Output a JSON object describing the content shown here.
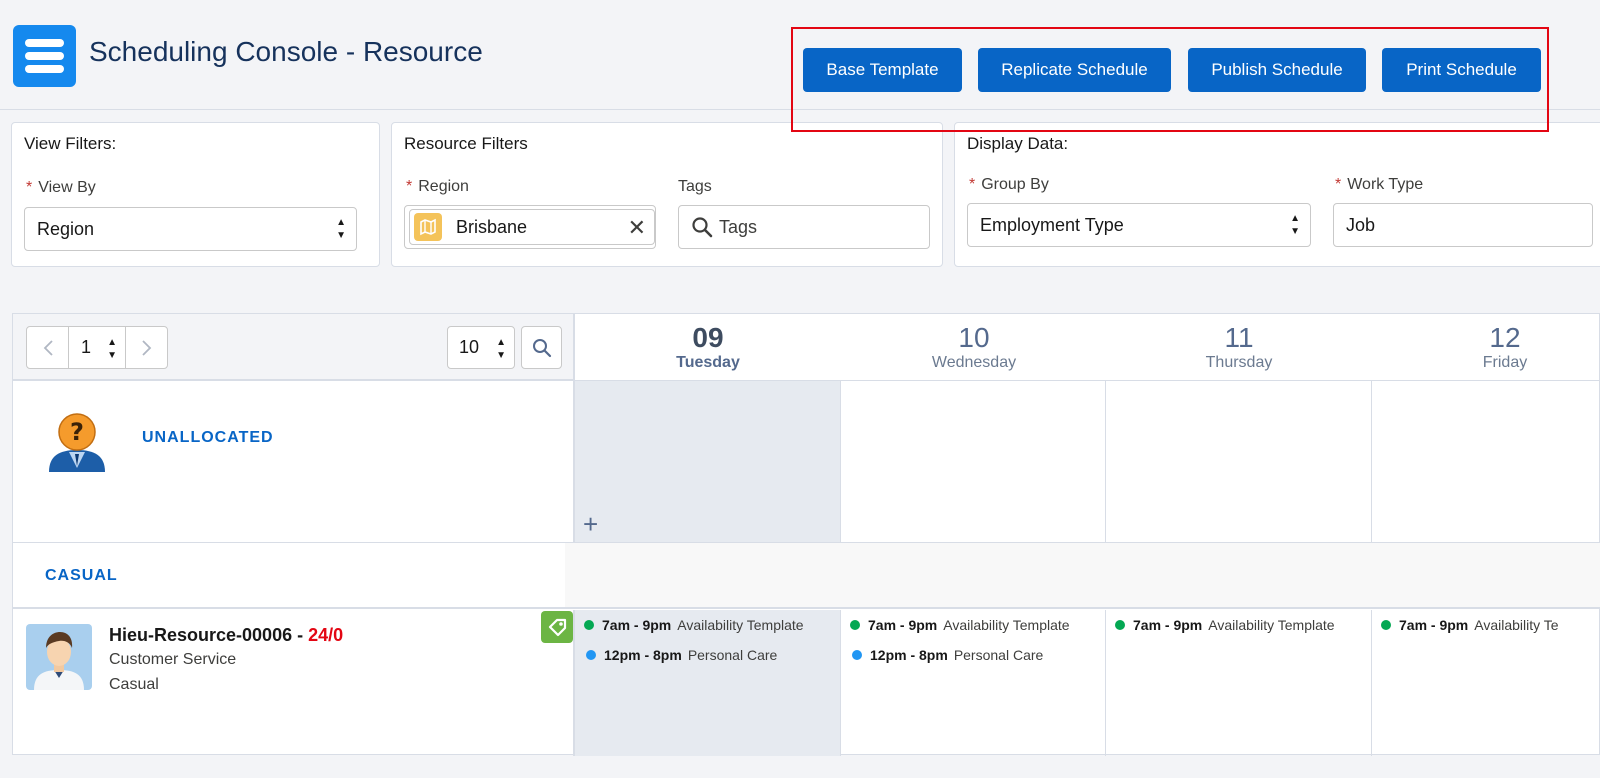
{
  "header": {
    "title": "Scheduling Console - Resource",
    "buttons": {
      "base_template": "Base Template",
      "replicate": "Replicate Schedule",
      "publish": "Publish Schedule",
      "print": "Print Schedule"
    }
  },
  "view_filters": {
    "title": "View Filters:",
    "view_by_label": "View By",
    "view_by_value": "Region"
  },
  "resource_filters": {
    "title": "Resource Filters",
    "region_label": "Region",
    "region_pill": "Brisbane",
    "tags_label": "Tags",
    "tags_placeholder": "Tags"
  },
  "display_data": {
    "title": "Display Data:",
    "group_by_label": "Group By",
    "group_by_value": "Employment Type",
    "work_type_label": "Work Type",
    "work_type_value": "Job"
  },
  "pager": {
    "page": "1",
    "page_size": "10"
  },
  "days": [
    {
      "num": "09",
      "name": "Tuesday"
    },
    {
      "num": "10",
      "name": "Wednesday"
    },
    {
      "num": "11",
      "name": "Thursday"
    },
    {
      "num": "12",
      "name": "Friday"
    }
  ],
  "unallocated_label": "UNALLOCATED",
  "add_symbol": "+",
  "group_label": "CASUAL",
  "resource": {
    "name": "Hieu-Resource-00006",
    "separator": " - ",
    "hours": "24/0",
    "role": "Customer Service",
    "employment": "Casual"
  },
  "shifts": {
    "availability_time": "7am - 9pm",
    "availability_label": "Availability Template",
    "care_time": "12pm - 8pm",
    "care_label": "Personal Care",
    "availability_label_truncated": "Availability Te"
  },
  "colors": {
    "button": "#0865c6",
    "highlight": "#e30613",
    "availability_dot": "#04a853",
    "care_dot": "#2196f3",
    "hours": "#e30613"
  }
}
